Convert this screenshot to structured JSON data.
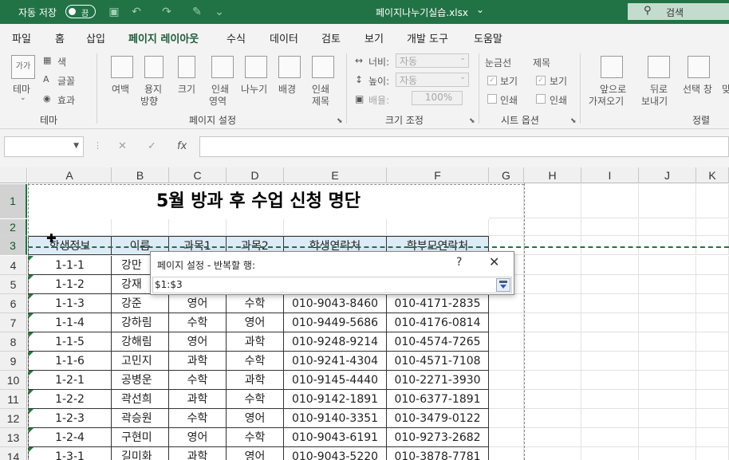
{
  "window": {
    "autosave_label": "자동 저장",
    "autosave_state": "끔",
    "title": "페이지나누기실습.xlsx",
    "title_dropdown": "⌄",
    "search": "검색"
  },
  "tabs": [
    "파일",
    "홈",
    "삽입",
    "페이지 레이아웃",
    "수식",
    "데이터",
    "검토",
    "보기",
    "개발 도구",
    "도움말"
  ],
  "active_tab": "페이지 레이아웃",
  "ribbon": {
    "theme": {
      "big_label": "테마",
      "big_icon_text": "가가",
      "colors": "색",
      "fonts": "글꼴",
      "effects": "효과",
      "group": "테마"
    },
    "page_setup": {
      "margins": [
        "여백",
        ""
      ],
      "orientation": [
        "용지",
        "방향"
      ],
      "size": [
        "크기",
        ""
      ],
      "print_area": [
        "인쇄",
        "영역"
      ],
      "breaks": [
        "나누기",
        ""
      ],
      "background": [
        "배경",
        ""
      ],
      "print_titles": [
        "인쇄",
        "제목"
      ],
      "group": "페이지 설정"
    },
    "scale": {
      "width_label": "너비:",
      "width_value": "자동",
      "height_label": "높이:",
      "height_value": "자동",
      "scale_label": "배율:",
      "scale_value": "100%",
      "group": "크기 조정"
    },
    "sheet_options": {
      "gridlines": "눈금선",
      "headings": "제목",
      "view": "보기",
      "print": "인쇄",
      "group": "시트 옵션"
    },
    "arrange": {
      "bring_forward": [
        "앞으로",
        "가져오기"
      ],
      "send_backward": [
        "뒤로",
        "보내기"
      ],
      "selection_pane": "선택 창",
      "group": "정렬",
      "cut": "맞"
    }
  },
  "formula_bar": {
    "fx": "fx",
    "cancel": "✕",
    "enter": "✓"
  },
  "columns": [
    "A",
    "B",
    "C",
    "D",
    "E",
    "F",
    "G",
    "H",
    "I",
    "J",
    "K"
  ],
  "rows": [
    "1",
    "2",
    "3",
    "4",
    "5",
    "6",
    "7",
    "8",
    "9",
    "10",
    "11",
    "12",
    "13",
    "14"
  ],
  "sheet": {
    "title": "5월 방과 후 수업 신청 명단",
    "headers": [
      "학생정보",
      "이름",
      "과목1",
      "과목2",
      "학생연락처",
      "학부모연락처"
    ],
    "data": [
      [
        "1-1-1",
        "강만",
        "",
        "",
        "",
        ""
      ],
      [
        "1-1-2",
        "강재",
        "",
        "",
        "",
        ""
      ],
      [
        "1-1-3",
        "강준",
        "영어",
        "수학",
        "010-9043-8460",
        "010-4171-2835"
      ],
      [
        "1-1-4",
        "강하림",
        "수학",
        "영어",
        "010-9449-5686",
        "010-4176-0814"
      ],
      [
        "1-1-5",
        "강해림",
        "영어",
        "과학",
        "010-9248-9214",
        "010-4574-7265"
      ],
      [
        "1-1-6",
        "고민지",
        "과학",
        "수학",
        "010-9241-4304",
        "010-4571-7108"
      ],
      [
        "1-2-1",
        "공병운",
        "수학",
        "과학",
        "010-9145-4440",
        "010-2271-3930"
      ],
      [
        "1-2-2",
        "곽선희",
        "과학",
        "수학",
        "010-9142-1891",
        "010-6377-1891"
      ],
      [
        "1-2-3",
        "곽승원",
        "수학",
        "영어",
        "010-9140-3351",
        "010-3479-0122"
      ],
      [
        "1-2-4",
        "구현미",
        "영어",
        "수학",
        "010-9043-6191",
        "010-9273-2682"
      ],
      [
        "1-3-1",
        "길미화",
        "과학",
        "영어",
        "010-9043-5220",
        "010-3878-7781"
      ]
    ]
  },
  "dialog": {
    "title": "페이지 설정 - 반복할 행:",
    "help": "?",
    "close": "✕",
    "value": "$1:$3"
  },
  "colors": {
    "accent": "#217346",
    "header_fill": "#ddebf7"
  }
}
